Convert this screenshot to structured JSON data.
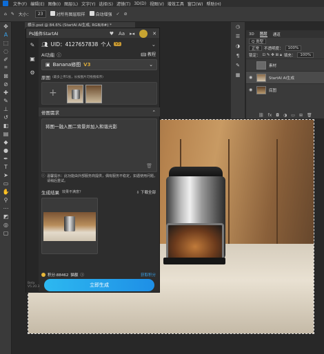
{
  "menubar": {
    "items": [
      "文件(F)",
      "编辑(E)",
      "图像(I)",
      "图层(L)",
      "文字(Y)",
      "选择(S)",
      "滤镜(T)",
      "3D(D)",
      "视图(V)",
      "增效工具",
      "窗口(W)",
      "帮助(H)"
    ]
  },
  "options": {
    "size_label": "大小：",
    "size_value": "23",
    "sample_all": "对所有图层取样",
    "auto_enhance": "自动增强",
    "confirm": "✓",
    "cancel": "⊘"
  },
  "document": {
    "tab_title": "横示.psd @ 84.6% (StartAI AI生成, RGB/8#) *"
  },
  "layers": {
    "tabs": [
      "3D",
      "图层",
      "通道"
    ],
    "blend_mode": "正常",
    "opacity_label": "不透明度：",
    "opacity_value": "100%",
    "lock_label": "锁定：",
    "fill_label": "填充：",
    "fill_value": "100%",
    "items": [
      {
        "name": "素材",
        "visible": false
      },
      {
        "name": "StartAI AI生成",
        "visible": true,
        "active": true
      },
      {
        "name": "底图",
        "visible": true
      }
    ]
  },
  "plugin": {
    "title": "Ps插件StartAI",
    "title_ctrls": {
      "favorite": "♥",
      "translate": "Aa"
    },
    "uid": "UID：4127657838",
    "account_type": "个人",
    "vip": "V3",
    "ai_function_label": "AI功能",
    "tutorial_label": "教程",
    "model_name": "Banana修图",
    "model_version": "V3",
    "original_label": "原图",
    "original_hint": "(最多上传5张，长按图片可拖拽排序)",
    "demand_label": "修图需求",
    "prompt_text": "将图一融入图二背景并加入和谐光影",
    "tip_text": "温馨提示：此功能由外部服务商提供，偶有服务不稳定，如遇使用问题，请稍后重试。",
    "result_label": "生成结果",
    "result_hint": "效果不满意？",
    "download_all": "下载全部",
    "points_text": "积分:88462",
    "extra_label": "猫额",
    "get_points": "获取积分",
    "generate_label": "立即生成",
    "beta_label": "Beta",
    "version": "V5.20.3"
  }
}
